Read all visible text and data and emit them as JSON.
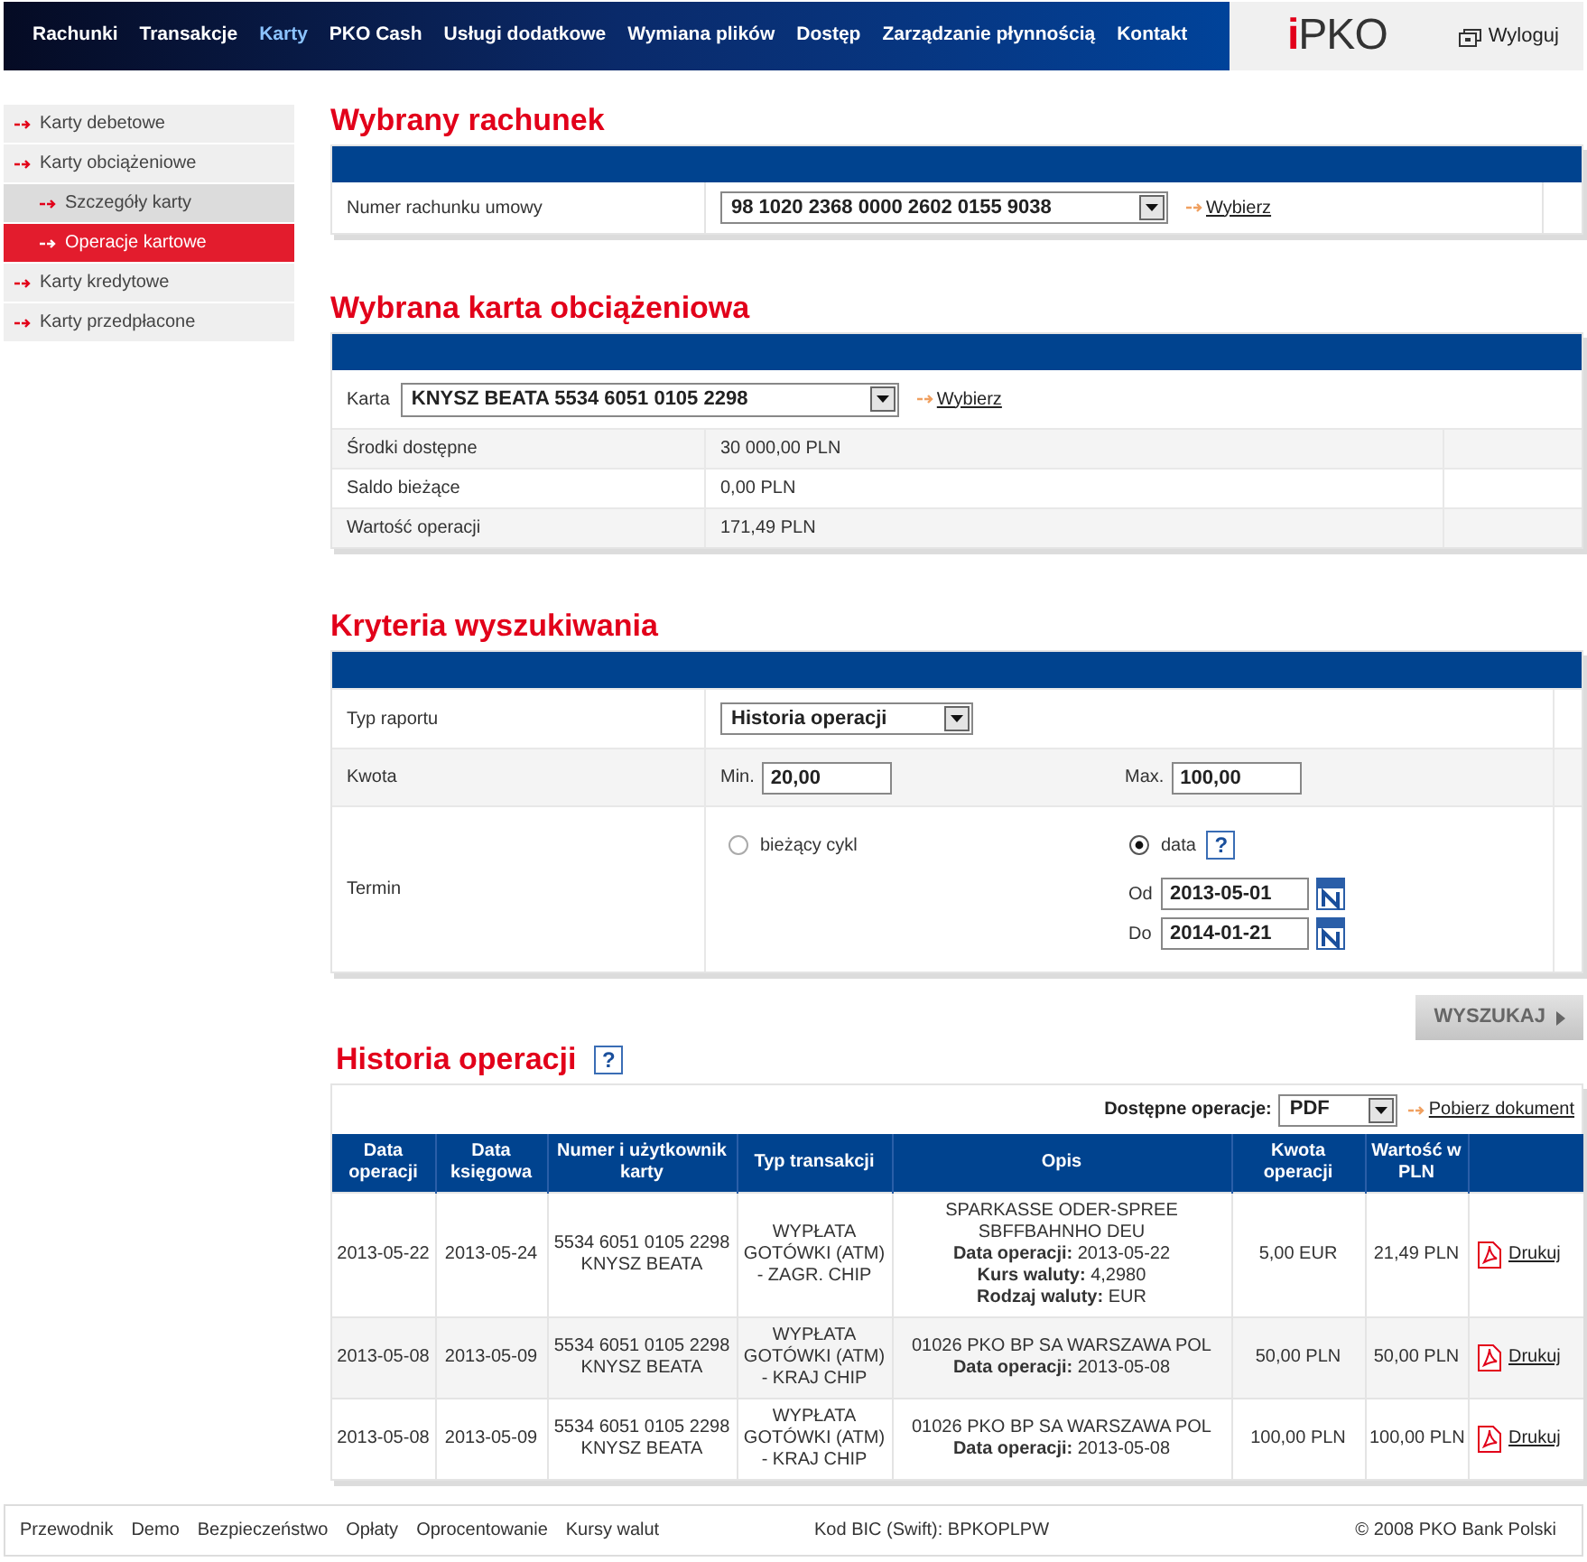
{
  "nav": {
    "items": [
      {
        "label": "Rachunki",
        "selected": false
      },
      {
        "label": "Transakcje",
        "selected": false
      },
      {
        "label": "Karty",
        "selected": true
      },
      {
        "label": "PKO Cash",
        "selected": false
      },
      {
        "label": "Usługi dodatkowe",
        "selected": false
      },
      {
        "label": "Wymiana plików",
        "selected": false
      },
      {
        "label": "Dostęp",
        "selected": false
      },
      {
        "label": "Zarządzanie płynnością",
        "selected": false
      },
      {
        "label": "Kontakt",
        "selected": false
      }
    ],
    "logo_mark": "i",
    "logo_text": "PKO",
    "logout": "Wyloguj"
  },
  "sidebar": {
    "items": [
      {
        "label": "Karty debetowe",
        "selected": false
      },
      {
        "label": "Karty obciążeniowe",
        "selected": false,
        "children": [
          {
            "label": "Szczegóły karty",
            "selected": false
          },
          {
            "label": "Operacje kartowe",
            "selected": true
          }
        ]
      },
      {
        "label": "Karty kredytowe",
        "selected": false
      },
      {
        "label": "Karty przedpłacone",
        "selected": false
      }
    ]
  },
  "account": {
    "title": "Wybrany rachunek",
    "label": "Numer rachunku umowy",
    "value": "98 1020 2368 0000 2602 0155 9038",
    "link": "Wybierz"
  },
  "card": {
    "title": "Wybrana karta obciążeniowa",
    "label": "Karta",
    "value": "KNYSZ BEATA 5534 6051 0105 2298",
    "link": "Wybierz",
    "rows": [
      {
        "label": "Środki dostępne",
        "value": "30 000,00 PLN"
      },
      {
        "label": "Saldo bieżące",
        "value": "0,00 PLN"
      },
      {
        "label": "Wartość operacji",
        "value": "171,49 PLN"
      }
    ]
  },
  "criteria": {
    "title": "Kryteria wyszukiwania",
    "report": {
      "label": "Typ raportu",
      "value": "Historia operacji"
    },
    "amount": {
      "label": "Kwota",
      "min_label": "Min.",
      "min": "20,00",
      "max_label": "Max.",
      "max": "100,00"
    },
    "term": {
      "label": "Termin",
      "options": [
        {
          "label": "bieżący cykl",
          "selected": false
        },
        {
          "label": "data",
          "selected": true
        }
      ],
      "help": "?",
      "from_label": "Od",
      "from": "2013-05-01",
      "to_label": "Do",
      "to": "2014-01-21"
    },
    "search_button": "WYSZUKAJ"
  },
  "history": {
    "title": "Historia operacji",
    "help": "?",
    "operations_label": "Dostępne operacje:",
    "format": "PDF",
    "download": "Pobierz dokument",
    "columns": [
      "Data operacji",
      "Data księgowa",
      "Numer i użytkownik karty",
      "Typ transakcji",
      "Opis",
      "Kwota operacji",
      "Wartość w PLN"
    ],
    "rows": [
      {
        "date_op": "2013-05-22",
        "date_book": "2013-05-24",
        "card_number": "5534 6051 0105 2298",
        "card_user": "KNYSZ BEATA",
        "type": "WYPŁATA GOTÓWKI (ATM) - ZAGR. CHIP",
        "description": [
          "SPARKASSE ODER-SPREE SBFFBAHNHO DEU",
          "**Data operacji:** 2013-05-22",
          "**Kurs waluty:** 4,2980",
          "**Rodzaj waluty:** EUR"
        ],
        "amount": "5,00 EUR",
        "value_pln": "21,49 PLN",
        "print": "Drukuj"
      },
      {
        "date_op": "2013-05-08",
        "date_book": "2013-05-09",
        "card_number": "5534 6051 0105 2298",
        "card_user": "KNYSZ BEATA",
        "type": "WYPŁATA GOTÓWKI (ATM) - KRAJ CHIP",
        "description": [
          "01026 PKO BP SA WARSZAWA POL",
          "**Data operacji:** 2013-05-08"
        ],
        "amount": "50,00 PLN",
        "value_pln": "50,00 PLN",
        "print": "Drukuj"
      },
      {
        "date_op": "2013-05-08",
        "date_book": "2013-05-09",
        "card_number": "5534 6051 0105 2298",
        "card_user": "KNYSZ BEATA",
        "type": "WYPŁATA GOTÓWKI (ATM) - KRAJ CHIP",
        "description": [
          "01026 PKO BP SA WARSZAWA POL",
          "**Data operacji:** 2013-05-08"
        ],
        "amount": "100,00 PLN",
        "value_pln": "100,00 PLN",
        "print": "Drukuj"
      }
    ]
  },
  "footer": {
    "links": [
      "Przewodnik",
      "Demo",
      "Bezpieczeństwo",
      "Opłaty",
      "Oprocentowanie",
      "Kursy walut"
    ],
    "bic": "Kod BIC (Swift): BPKOPLPW",
    "copyright": "© 2008 PKO Bank Polski"
  }
}
